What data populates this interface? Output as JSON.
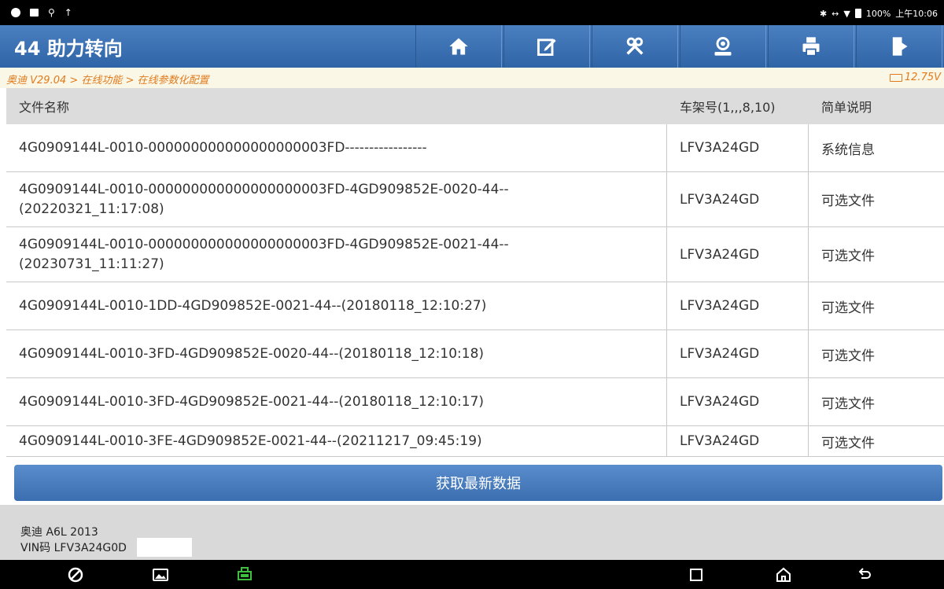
{
  "window": {
    "title": "44 助力转向"
  },
  "status_bar": {
    "battery": "100%",
    "time": "上午10:06"
  },
  "breadcrumb": {
    "path": "奥迪 V29.04 > 在线功能 > 在线参数化配置",
    "voltage": "12.75V"
  },
  "toolbar": {
    "icons": [
      "home-icon",
      "edit-icon",
      "tools-icon",
      "user-icon",
      "print-icon",
      "exit-icon"
    ]
  },
  "table": {
    "headers": [
      "文件名称",
      "车架号(1,,,8,10)",
      "简单说明"
    ],
    "rows": [
      {
        "file": "4G0909144L-0010-000000000000000000003FD-----------------",
        "vin": "LFV3A24GD",
        "desc": "系统信息"
      },
      {
        "file": "4G0909144L-0010-000000000000000000003FD-4GD909852E-0020-44--\n(20220321_11:17:08)",
        "vin": "LFV3A24GD",
        "desc": "可选文件"
      },
      {
        "file": "4G0909144L-0010-000000000000000000003FD-4GD909852E-0021-44--\n(20230731_11:11:27)",
        "vin": "LFV3A24GD",
        "desc": "可选文件"
      },
      {
        "file": "4G0909144L-0010-1DD-4GD909852E-0021-44--(20180118_12:10:27)",
        "vin": "LFV3A24GD",
        "desc": "可选文件"
      },
      {
        "file": "4G0909144L-0010-3FD-4GD909852E-0020-44--(20180118_12:10:18)",
        "vin": "LFV3A24GD",
        "desc": "可选文件"
      },
      {
        "file": "4G0909144L-0010-3FD-4GD909852E-0021-44--(20180118_12:10:17)",
        "vin": "LFV3A24GD",
        "desc": "可选文件"
      },
      {
        "file": "4G0909144L-0010-3FE-4GD909852E-0021-44--(20211217_09:45:19)",
        "vin": "LFV3A24GD",
        "desc": "可选文件"
      }
    ]
  },
  "actions": {
    "fetch_latest": "获取最新数据"
  },
  "vehicle": {
    "model": "奥迪 A6L 2013",
    "vin": "VIN码 LFV3A24G0D"
  },
  "colors": {
    "accent": "#3a6eb0",
    "breadcrumb": "#e07a1c",
    "header_bg": "#dcdcdc"
  }
}
